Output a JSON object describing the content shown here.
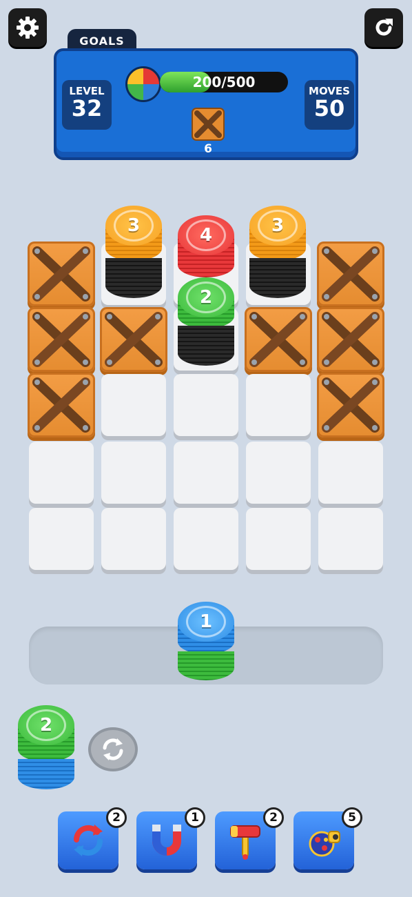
{
  "header": {
    "goals_tab": "GOALS",
    "level_label": "LEVEL",
    "level_value": "32",
    "moves_label": "MOVES",
    "moves_value": "50",
    "progress_text": "200/500",
    "progress_fraction": 0.4,
    "crate_goal_count": "6"
  },
  "board": {
    "stacks": [
      {
        "number": "3",
        "color": "orange"
      },
      {
        "number": "4",
        "color": "red"
      },
      {
        "number": "3",
        "color": "orange"
      },
      {
        "number": "2",
        "color": "green"
      }
    ]
  },
  "tray": {
    "stack_number": "1",
    "color": "blue"
  },
  "next": {
    "stack_number": "2",
    "colors": [
      "green",
      "blue"
    ]
  },
  "boosters": [
    {
      "name": "shuffle-icon",
      "count": "2"
    },
    {
      "name": "magnet-icon",
      "count": "1"
    },
    {
      "name": "hammer-icon",
      "count": "2"
    },
    {
      "name": "cannon-icon",
      "count": "5"
    }
  ],
  "colors": {
    "orange": "#f7a326",
    "red": "#e8383a",
    "green": "#3dbb3d",
    "blue": "#2f8ee6",
    "panel": "#1a6fd6"
  }
}
